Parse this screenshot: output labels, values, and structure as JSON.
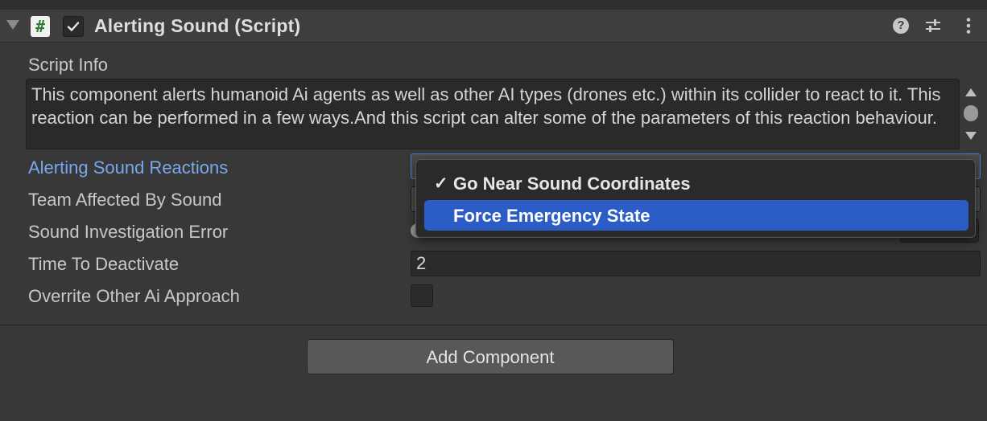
{
  "component": {
    "title": "Alerting Sound (Script)",
    "enabled": true,
    "script_icon_glyph": "#"
  },
  "header_icons": [
    "help-icon",
    "presets-icon",
    "more-menu-icon"
  ],
  "script_info": {
    "label": "Script Info",
    "text": "This component alerts humanoid Ai agents as well as other AI types (drones etc.) within its collider to react to it. This reaction can be performed in a few ways.And this script can alter some of the parameters of this reaction behaviour."
  },
  "fields": {
    "alerting_sound_reactions": "Alerting Sound Reactions",
    "team_affected_by_sound": "Team Affected By Sound",
    "sound_investigation_error": "Sound Investigation Error",
    "time_to_deactivate": "Time To Deactivate",
    "time_to_deactivate_value": "2",
    "overrite_other_ai_approach": "Overrite Other Ai Approach",
    "overrite_other_ai_approach_checked": false
  },
  "dropdown": {
    "options": [
      {
        "label": "Go Near Sound Coordinates",
        "checked": true,
        "highlighted": false
      },
      {
        "label": "Force Emergency State",
        "checked": false,
        "highlighted": true
      }
    ],
    "check_glyph": "✓"
  },
  "add_component_label": "Add Component",
  "colors": {
    "background": "#383838",
    "header": "#3e3e3e",
    "accent_label": "#7aa7ee",
    "highlight": "#2c5cc5"
  }
}
